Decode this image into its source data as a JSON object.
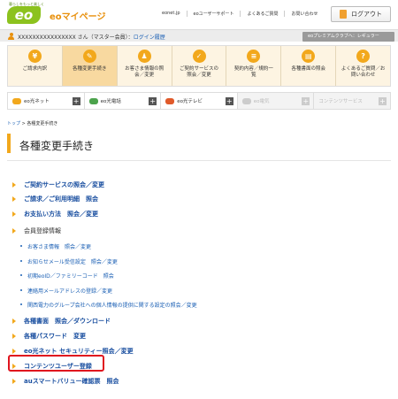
{
  "header": {
    "logo_tagline": "暮らしをもっと楽しく",
    "logo_mark": "eo",
    "site_title": "eoマイページ",
    "top_links": [
      "eonet.jp",
      "eoユーザーサポート",
      "よくあるご質問",
      "お問い合わせ"
    ],
    "logout_label": "ログアウト"
  },
  "userbar": {
    "user_name": "XXXXXXXXXXXXXXXX さん（マスター会員）：",
    "login_history": "ログイン履歴",
    "premium_label": "eoプレミアムクラブへ：レギュラー"
  },
  "main_nav": [
    {
      "icon": "¥",
      "label": "ご請求内訳",
      "active": false
    },
    {
      "icon": "✎",
      "label": "各種変更手続き",
      "active": true
    },
    {
      "icon": "♟",
      "label": "お客さま情報の照\n会／変更",
      "active": false
    },
    {
      "icon": "✓",
      "label": "ご契約サービスの\n照会／変更",
      "active": false
    },
    {
      "icon": "≡",
      "label": "契約内容／規約一\n覧",
      "active": false
    },
    {
      "icon": "▤",
      "label": "各種書面の照会",
      "active": false
    },
    {
      "icon": "?",
      "label": "よくあるご質問／お\n問い合わせ",
      "active": false
    }
  ],
  "service_tabs": [
    {
      "label": "eo光ネット",
      "color": "#f2a81c",
      "disabled": false
    },
    {
      "label": "eo光電話",
      "color": "#4ca34c",
      "disabled": false
    },
    {
      "label": "eo光テレビ",
      "color": "#e05a2a",
      "disabled": false
    },
    {
      "label": "eo電気",
      "color": "#cccccc",
      "disabled": true
    },
    {
      "label": "コンテンツサービス",
      "color": "#cccccc",
      "disabled": true
    }
  ],
  "breadcrumb": {
    "home": "トップ",
    "sep": " > ",
    "current": "各種変更手続き"
  },
  "page_title": "各種変更手続き",
  "menu": {
    "contract": "ご契約サービスの照会／変更",
    "billing": "ご請求／ご利用明細　照会",
    "payment": "お支払い方法　照会／変更",
    "member_info": "会員登録情報",
    "sub_1": "お客さま情報　照会／変更",
    "sub_2": "お知らせメール受信設定　照会／変更",
    "sub_3": "初期eoID／ファミリーコード　照会",
    "sub_4": "連絡用メールアドレスの登録／変更",
    "sub_5": "関西電力のグループ会社への個人情報の提供に関する設定の照会／変更",
    "documents": "各種書面　照会／ダウンロード",
    "password": "各種パスワード　変更",
    "security": "eo光ネット セキュリティー照会／変更",
    "content_user": "コンテンツユーザー登録",
    "au_smart": "auスマートバリュー確認票　照会"
  }
}
